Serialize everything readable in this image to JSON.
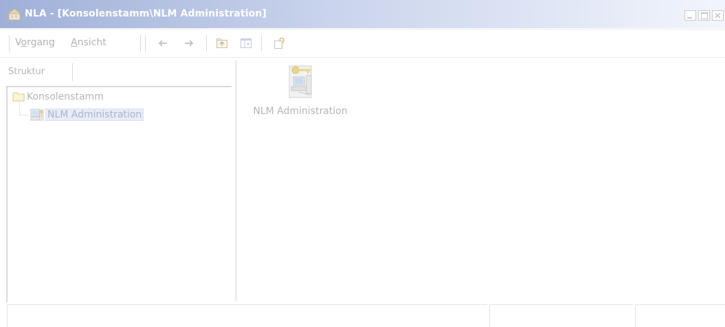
{
  "window": {
    "title": "NLA - [Konsolenstamm\\NLM Administration]",
    "title_color": "#ffffff",
    "titlebar_gradient": [
      "#9fb0d8",
      "#f2f5fc"
    ],
    "icons": [
      "app-icon",
      "minimize-icon",
      "maximize-icon",
      "close-icon"
    ]
  },
  "menu": {
    "items": [
      {
        "label_pre": "V",
        "label_ul": "o",
        "label_post": "rgang"
      },
      {
        "label_pre": "",
        "label_ul": "A",
        "label_post": "nsicht"
      }
    ]
  },
  "toolbar": {
    "icons": [
      "back-arrow-icon",
      "forward-arrow-icon",
      "up-one-level-icon",
      "show-hide-tree-icon",
      "help-icon"
    ]
  },
  "left_pane": {
    "tab_label": "Struktur",
    "tree": [
      {
        "label": "Konsolenstamm",
        "icon": "folder-icon",
        "selected": false
      },
      {
        "label": "NLM Administration",
        "icon": "admin-computer-icon",
        "selected": true
      }
    ]
  },
  "right_pane": {
    "items": [
      {
        "label": "NLM Administration",
        "icon": "nlm-admin-large-icon"
      }
    ]
  },
  "status_bar": {
    "cells": [
      "",
      "",
      ""
    ]
  }
}
